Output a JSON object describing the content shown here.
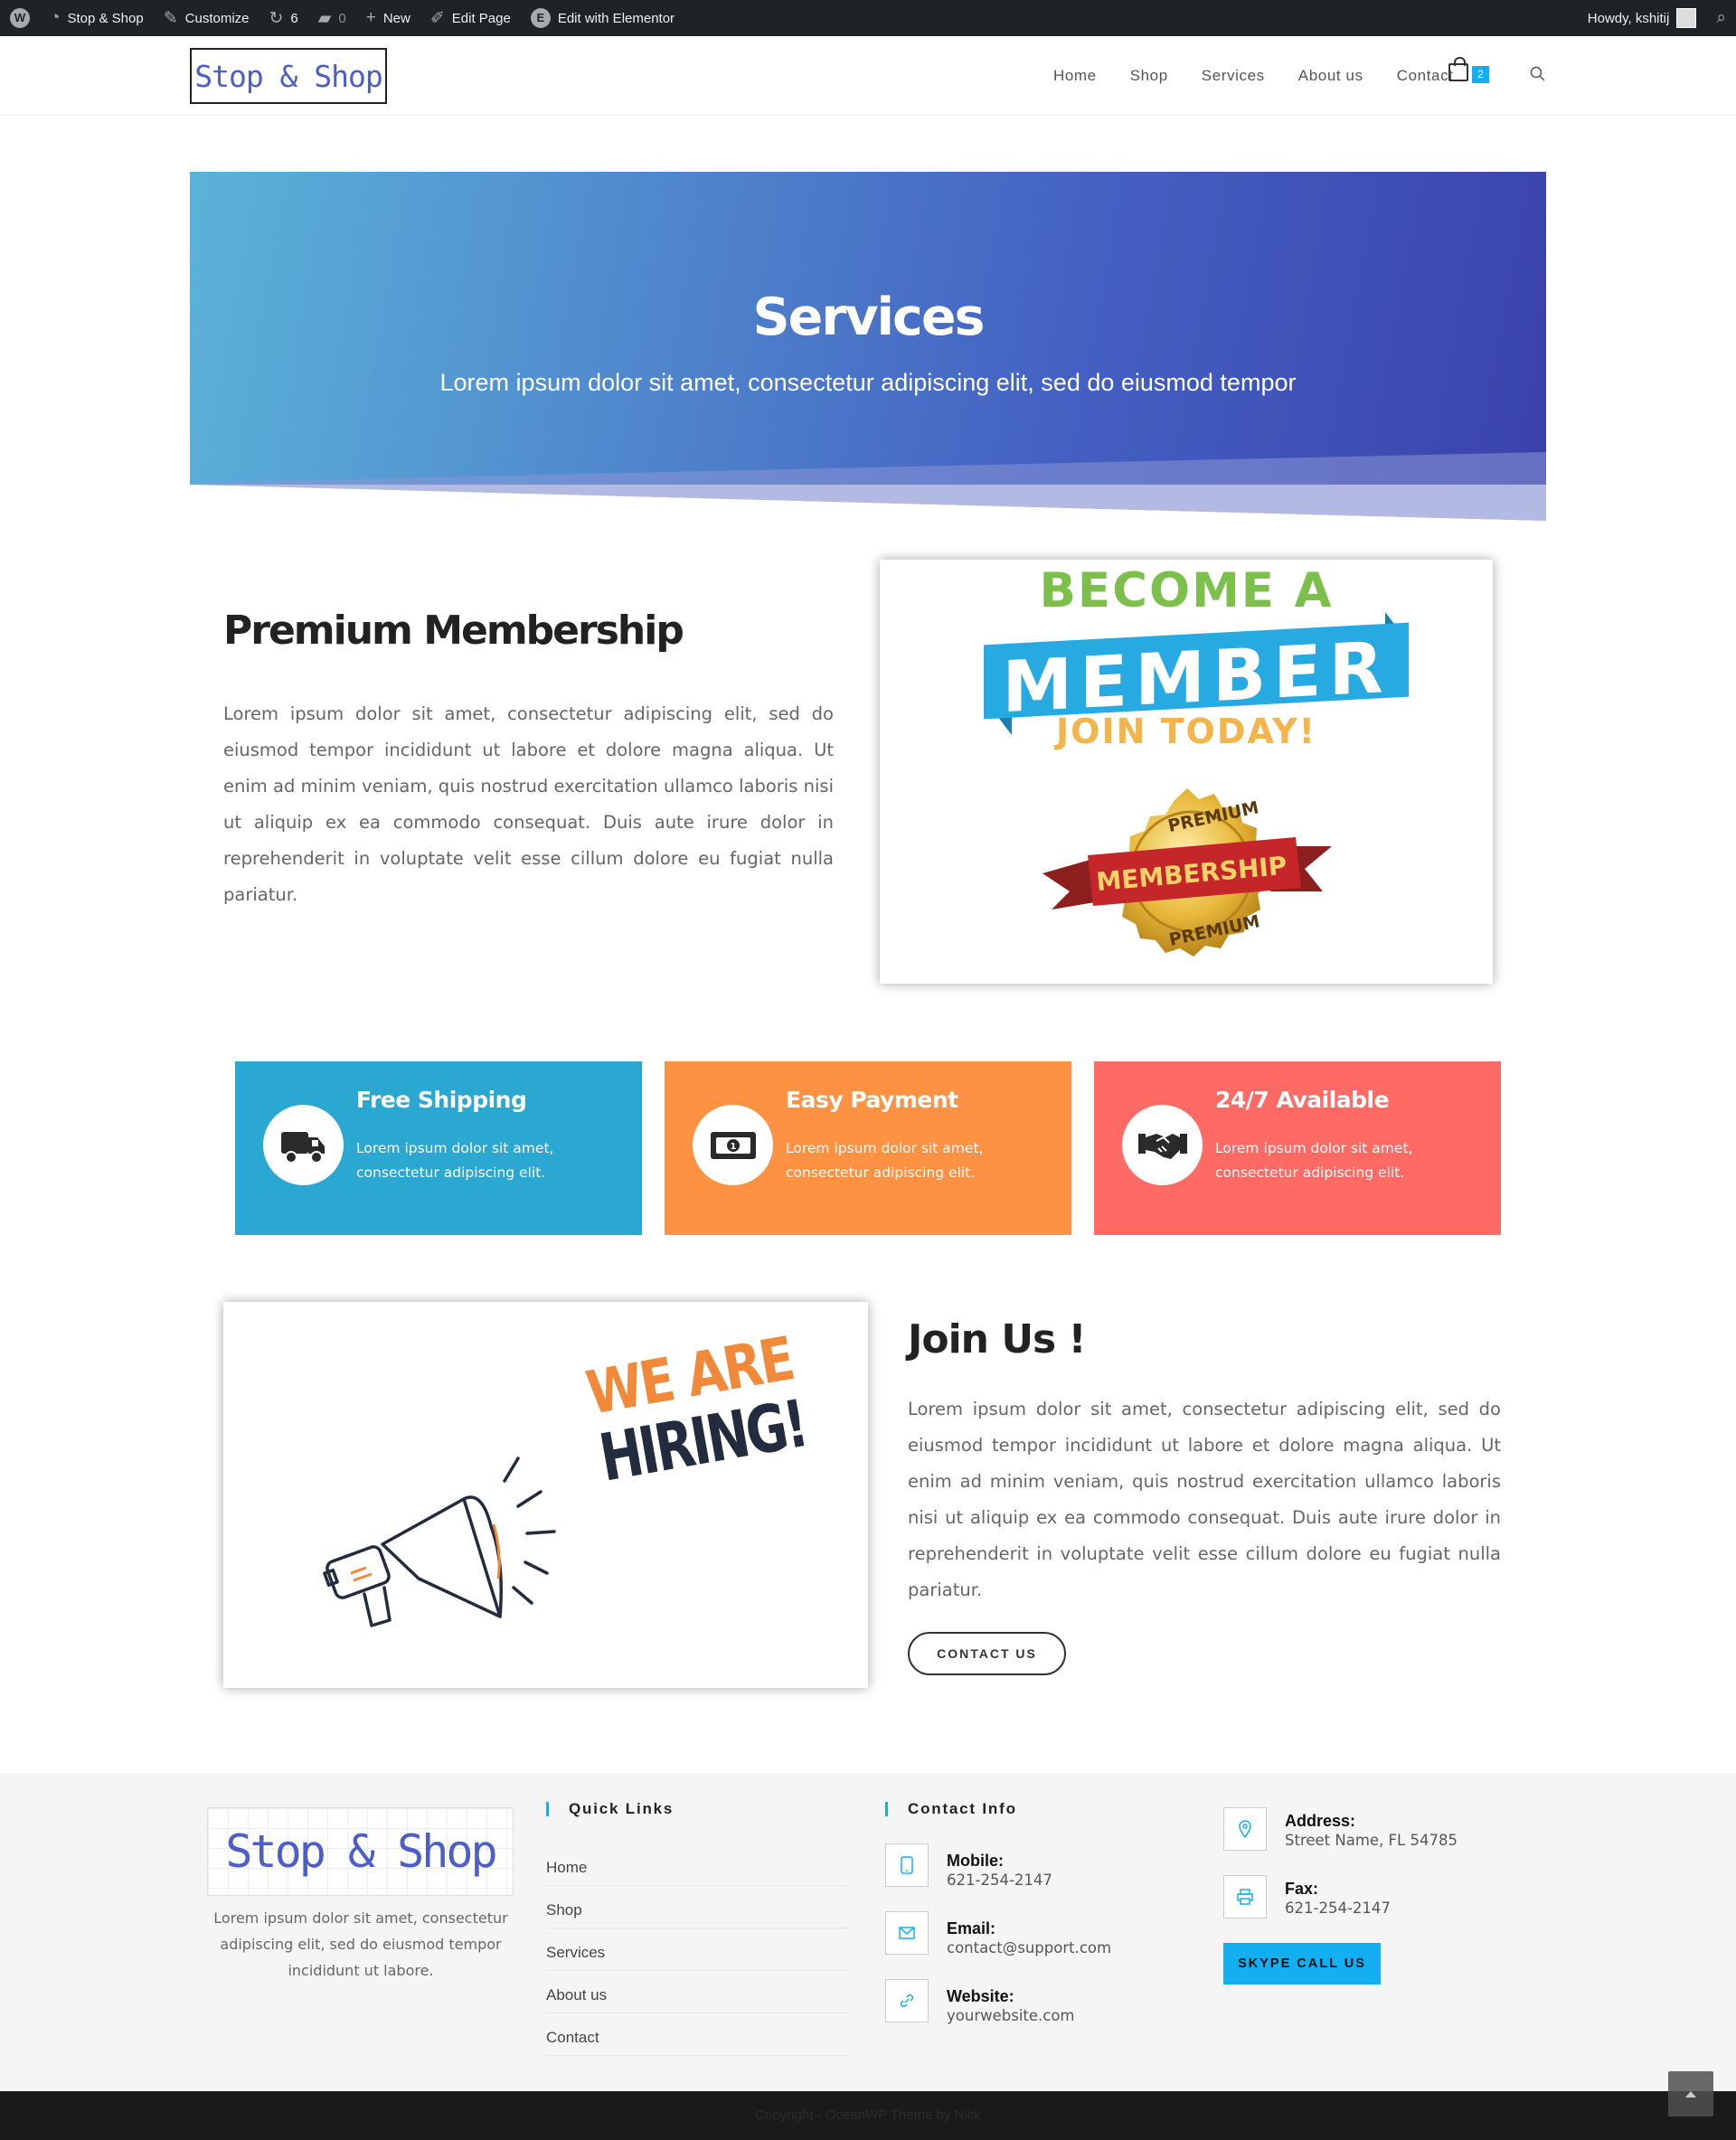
{
  "admin_bar": {
    "site_name": "Stop & Shop",
    "customize": "Customize",
    "updates_count": "6",
    "comments_count": "0",
    "new": "New",
    "edit_page": "Edit Page",
    "edit_elementor": "Edit with Elementor",
    "howdy": "Howdy, kshitij"
  },
  "header": {
    "logo": "Stop & Shop",
    "nav": [
      "Home",
      "Shop",
      "Services",
      "About us",
      "Contact"
    ],
    "cart_count": "2"
  },
  "hero": {
    "title": "Services",
    "subtitle": "Lorem ipsum dolor sit amet, consectetur adipiscing elit, sed do eiusmod tempor"
  },
  "premium": {
    "title": "Premium Membership",
    "text": "Lorem ipsum dolor sit amet, consectetur adipiscing elit, sed do eiusmod tempor incididunt ut labore et dolore magna aliqua. Ut enim ad minim veniam, quis nostrud exercitation ullamco laboris nisi ut aliquip ex ea commodo consequat. Duis aute irure dolor in reprehenderit in voluptate velit esse cillum dolore eu fugiat nulla pariatur.",
    "image": {
      "line1": "BECOME A",
      "line2": "MEMBER",
      "line3": "JOIN TODAY!",
      "badge_top": "PREMIUM",
      "badge_mid": "MEMBERSHIP",
      "badge_bottom": "PREMIUM"
    }
  },
  "features": [
    {
      "title": "Free Shipping",
      "text": "Lorem ipsum dolor sit amet, consectetur adipiscing elit.",
      "icon": "truck-icon",
      "color": "#2aa8d1"
    },
    {
      "title": "Easy Payment",
      "text": "Lorem ipsum dolor sit amet, consectetur adipiscing elit.",
      "icon": "money-bill-icon",
      "color": "#ff9142"
    },
    {
      "title": "24/7 Available",
      "text": "Lorem ipsum dolor sit amet, consectetur adipiscing elit.",
      "icon": "handshake-icon",
      "color": "#ff6b64"
    }
  ],
  "join": {
    "image_line1": "WE ARE",
    "image_line2": "HIRING!",
    "title": "Join Us !",
    "text": "Lorem ipsum dolor sit amet, consectetur adipiscing elit, sed do eiusmod tempor incididunt ut labore et dolore magna aliqua. Ut enim ad minim veniam, quis nostrud exercitation ullamco laboris nisi ut aliquip ex ea commodo consequat. Duis aute irure dolor in reprehenderit in voluptate velit esse cillum dolore eu fugiat nulla pariatur.",
    "button": "CONTACT US"
  },
  "footer": {
    "logo": "Stop & Shop",
    "about": "Lorem ipsum dolor sit amet, consectetur adipiscing elit, sed do eiusmod tempor incididunt ut labore.",
    "quick_links_title": "Quick Links",
    "quick_links": [
      "Home",
      "Shop",
      "Services",
      "About us",
      "Contact"
    ],
    "contact_title": "Contact Info",
    "mobile_label": "Mobile:",
    "mobile": "621-254-2147",
    "email_label": "Email:",
    "email": "contact@support.com",
    "website_label": "Website:",
    "website": "yourwebsite.com",
    "address_label": "Address:",
    "address": "Street Name, FL 54785",
    "fax_label": "Fax:",
    "fax": "621-254-2147",
    "skype_button": "SKYPE CALL US",
    "copyright": "Copyright - OceanWP Theme by Nick"
  },
  "colors": {
    "accent": "#13aff0",
    "logo_blue": "#4b5ec9",
    "admin_bar": "#1d2327"
  }
}
